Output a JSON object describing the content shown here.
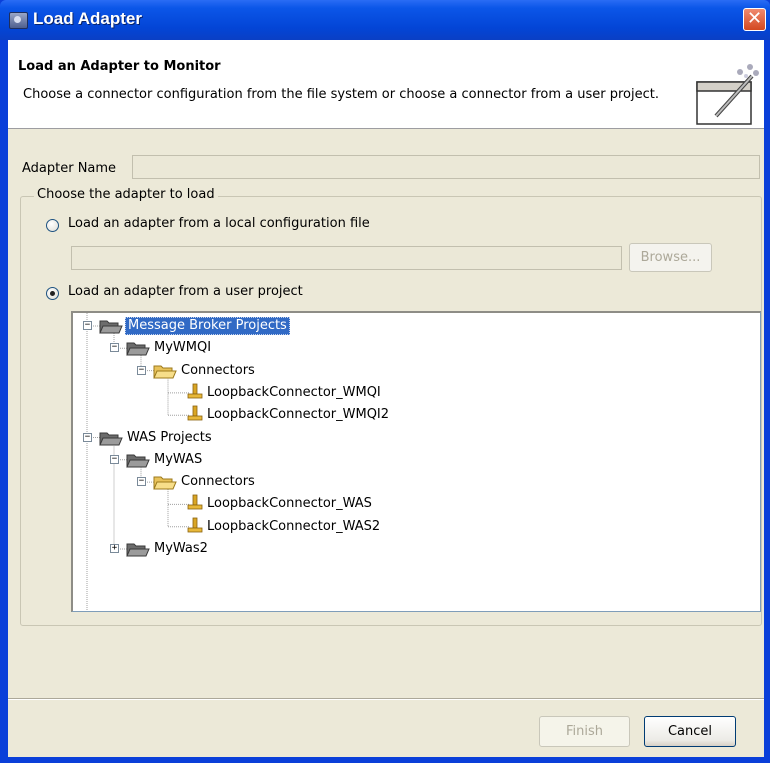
{
  "window": {
    "title": "Load Adapter",
    "close_glyph": "✕"
  },
  "header": {
    "title": "Load an Adapter to Monitor",
    "description": "Choose a connector configuration from the file system or choose a connector from a user project."
  },
  "adapter_name": {
    "label": "Adapter Name",
    "value": ""
  },
  "group": {
    "legend": "Choose the adapter to load",
    "option_file": {
      "label": "Load an adapter from a local configuration file",
      "checked": false
    },
    "file_path": "",
    "browse_label": "Browse...",
    "option_project": {
      "label": "Load an adapter from a user project",
      "checked": true
    }
  },
  "tree": [
    {
      "label": "Message Broker Projects",
      "depth": 0,
      "icon": "folder-open-icon",
      "expander": "−",
      "selected": true
    },
    {
      "label": "MyWMQI",
      "depth": 1,
      "icon": "folder-open-icon",
      "expander": "−"
    },
    {
      "label": "Connectors",
      "depth": 2,
      "icon": "folder-open-yellow-icon",
      "expander": "−"
    },
    {
      "label": "LoopbackConnector_WMQI",
      "depth": 3,
      "icon": "connector-icon"
    },
    {
      "label": "LoopbackConnector_WMQI2",
      "depth": 3,
      "icon": "connector-icon"
    },
    {
      "label": "WAS Projects",
      "depth": 0,
      "icon": "folder-open-icon",
      "expander": "−"
    },
    {
      "label": "MyWAS",
      "depth": 1,
      "icon": "folder-open-icon",
      "expander": "−"
    },
    {
      "label": "Connectors",
      "depth": 2,
      "icon": "folder-open-yellow-icon",
      "expander": "−"
    },
    {
      "label": "LoopbackConnector_WAS",
      "depth": 3,
      "icon": "connector-icon"
    },
    {
      "label": "LoopbackConnector_WAS2",
      "depth": 3,
      "icon": "connector-icon"
    },
    {
      "label": "MyWas2",
      "depth": 1,
      "icon": "folder-open-icon",
      "expander": "+"
    }
  ],
  "buttons": {
    "finish": "Finish",
    "cancel": "Cancel"
  },
  "colors": {
    "title_bar": "#0345d6",
    "dialog_bg": "#ece9d8",
    "selection": "#316ac5",
    "close_button": "#d34820"
  }
}
